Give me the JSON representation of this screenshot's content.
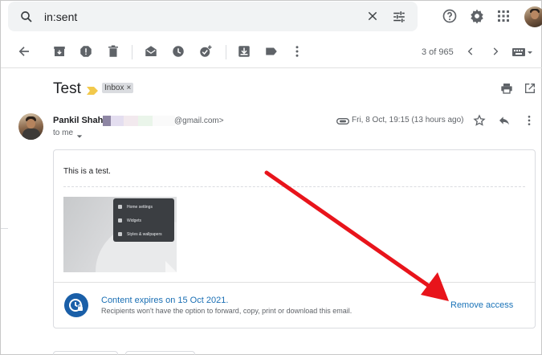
{
  "search": {
    "query": "in:sent"
  },
  "toolbar": {
    "count": "3 of 965"
  },
  "email": {
    "subject": "Test",
    "label": "Inbox",
    "label_close": "×",
    "sender_name": "Pankil Shah",
    "sender_email_domain": "@gmail.com>",
    "recipient": "to me",
    "date": "Fri, 8 Oct, 19:15 (13 hours ago)",
    "body": "This is a test."
  },
  "thumbnail_menu": [
    "Home settings",
    "Widgets",
    "Styles & wallpapers"
  ],
  "confidential": {
    "title": "Content expires on 15 Oct 2021.",
    "subtitle": "Recipients won't have the option to forward, copy, print or download this email.",
    "action": "Remove access"
  },
  "colors": {
    "arrow": "#e8141b",
    "link": "#1a73b8",
    "importance": "#f2c94c",
    "expire_icon": "#1a5fa8"
  }
}
